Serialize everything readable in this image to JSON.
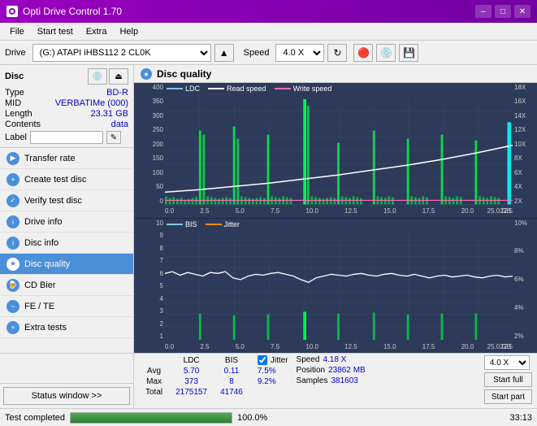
{
  "titleBar": {
    "title": "Opti Drive Control 1.70",
    "minimize": "–",
    "maximize": "□",
    "close": "✕"
  },
  "menuBar": {
    "items": [
      "File",
      "Start test",
      "Extra",
      "Help"
    ]
  },
  "toolbar": {
    "driveLabel": "Drive",
    "driveValue": "(G:) ATAPI iHBS112  2 CL0K",
    "speedLabel": "Speed",
    "speedValue": "4.0 X"
  },
  "disc": {
    "title": "Disc",
    "typeLabel": "Type",
    "typeValue": "BD-R",
    "midLabel": "MID",
    "midValue": "VERBATIMe (000)",
    "lengthLabel": "Length",
    "lengthValue": "23.31 GB",
    "contentsLabel": "Contents",
    "contentsValue": "data",
    "labelLabel": "Label",
    "labelValue": ""
  },
  "navItems": [
    {
      "id": "transfer-rate",
      "label": "Transfer rate",
      "active": false
    },
    {
      "id": "create-test-disc",
      "label": "Create test disc",
      "active": false
    },
    {
      "id": "verify-test-disc",
      "label": "Verify test disc",
      "active": false
    },
    {
      "id": "drive-info",
      "label": "Drive info",
      "active": false
    },
    {
      "id": "disc-info",
      "label": "Disc info",
      "active": false
    },
    {
      "id": "disc-quality",
      "label": "Disc quality",
      "active": true
    },
    {
      "id": "cd-bier",
      "label": "CD Bier",
      "active": false
    },
    {
      "id": "fe-te",
      "label": "FE / TE",
      "active": false
    },
    {
      "id": "extra-tests",
      "label": "Extra tests",
      "active": false
    }
  ],
  "statusWindowBtn": "Status window >>",
  "chart": {
    "title": "Disc quality",
    "section1": {
      "legendLDC": "LDC",
      "legendRead": "Read speed",
      "legendWrite": "Write speed",
      "yLabels": [
        "400",
        "350",
        "300",
        "250",
        "200",
        "150",
        "100",
        "50",
        "0"
      ],
      "yLabelsRight": [
        "18X",
        "16X",
        "14X",
        "12X",
        "10X",
        "8X",
        "6X",
        "4X",
        "2X"
      ],
      "xLabels": [
        "0.0",
        "2.5",
        "5.0",
        "7.5",
        "10.0",
        "12.5",
        "15.0",
        "17.5",
        "20.0",
        "22.5",
        "25.0"
      ],
      "xUnit": "GB"
    },
    "section2": {
      "legendBIS": "BIS",
      "legendJitter": "Jitter",
      "yLabels": [
        "10",
        "9",
        "8",
        "7",
        "6",
        "5",
        "4",
        "3",
        "2",
        "1"
      ],
      "yLabelsRight": [
        "10%",
        "8%",
        "6%",
        "4%",
        "2%"
      ],
      "xLabels": [
        "0.0",
        "2.5",
        "5.0",
        "7.5",
        "10.0",
        "12.5",
        "15.0",
        "17.5",
        "20.0",
        "22.5",
        "25.0"
      ],
      "xUnit": "GB"
    }
  },
  "stats": {
    "headers": [
      "",
      "LDC",
      "BIS",
      "",
      "Jitter",
      "Speed",
      ""
    ],
    "avgLabel": "Avg",
    "avgLDC": "5.70",
    "avgBIS": "0.11",
    "avgJitter": "7.5%",
    "maxLabel": "Max",
    "maxLDC": "373",
    "maxBIS": "8",
    "maxJitter": "9.2%",
    "totalLabel": "Total",
    "totalLDC": "2175157",
    "totalBIS": "41746",
    "jitterLabel": "Jitter",
    "speedLabel": "Speed",
    "speedValue": "4.18 X",
    "speedDropdown": "4.0 X",
    "positionLabel": "Position",
    "positionValue": "23862 MB",
    "samplesLabel": "Samples",
    "samplesValue": "381603",
    "startFullBtn": "Start full",
    "startPartBtn": "Start part"
  },
  "finalBar": {
    "statusText": "Test completed",
    "progressPercent": 100,
    "progressLabel": "100.0%",
    "timeText": "33:13"
  }
}
